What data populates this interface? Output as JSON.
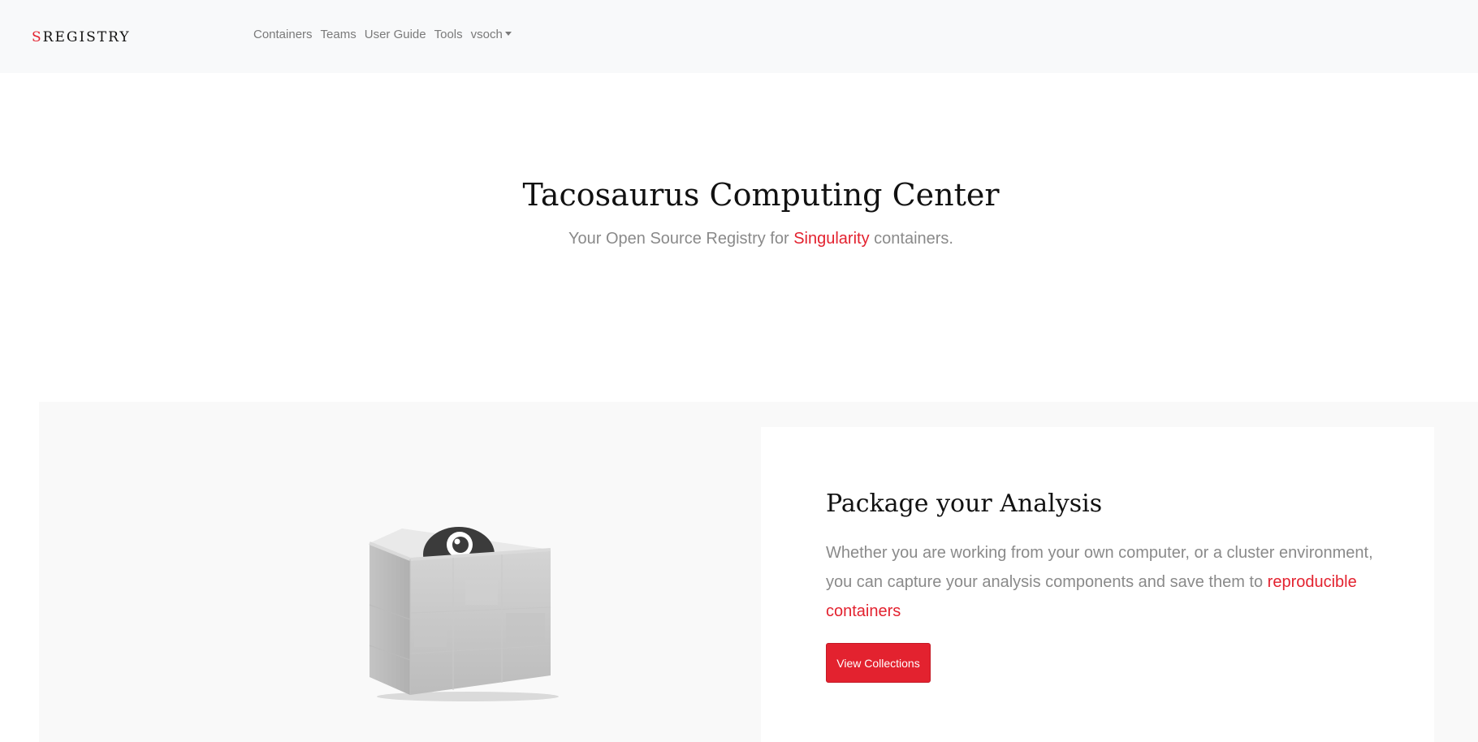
{
  "navbar": {
    "brand_first": "S",
    "brand_rest": "REGISTRY",
    "links": [
      "Containers",
      "Teams",
      "User Guide",
      "Tools"
    ],
    "user": "vsoch"
  },
  "hero": {
    "title": "Tacosaurus Computing Center",
    "sub_before": "Your Open Source Registry for ",
    "sub_link": "Singularity",
    "sub_after": " containers."
  },
  "feature": {
    "title": "Package your Analysis",
    "text_before": "Whether you are working from your own computer, or a cluster environment, you can capture your analysis components and save them to ",
    "text_link": "reproducible containers",
    "button_label": "View Collections",
    "illustration_icon": "container-box-icon"
  },
  "colors": {
    "accent": "#e3222f",
    "navbar_bg": "#f8f9fa",
    "muted_text": "#8a8a8a"
  }
}
